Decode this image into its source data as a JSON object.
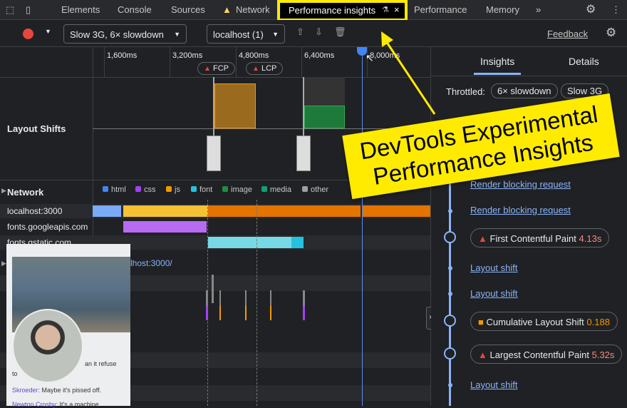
{
  "tabs": {
    "items": [
      "Elements",
      "Console",
      "Sources",
      "Network",
      "Performance insights",
      "Performance",
      "Memory"
    ],
    "more": "»",
    "active": "Performance insights"
  },
  "toolbar": {
    "throttle": "Slow 3G, 6× slowdown",
    "target": "localhost (1)",
    "feedback": "Feedback"
  },
  "ruler": {
    "ticks": [
      "1,600ms",
      "3,200ms",
      "4,800ms",
      "6,400ms",
      "8,000ms"
    ],
    "markers": [
      "FCP",
      "LCP"
    ]
  },
  "tracks": {
    "layout_shifts": "Layout Shifts",
    "network": "Network"
  },
  "legend": [
    {
      "label": "html",
      "color": "#4285f4"
    },
    {
      "label": "css",
      "color": "#a142f4"
    },
    {
      "label": "js",
      "color": "#f29900"
    },
    {
      "label": "font",
      "color": "#24c1e0"
    },
    {
      "label": "image",
      "color": "#1e8e3e"
    },
    {
      "label": "media",
      "color": "#129e7a"
    },
    {
      "label": "other",
      "color": "#9aa0a6"
    }
  ],
  "network_rows": [
    "localhost:3000",
    "fonts.googleapis.com",
    "fonts.gstatic.com"
  ],
  "main_thread_url": "lhost:3000/",
  "side": {
    "tabs": [
      "Insights",
      "Details"
    ],
    "throttled_label": "Throttled:",
    "throttle_chips": [
      "6× slowdown",
      "Slow 3G"
    ],
    "items": [
      {
        "type": "link",
        "label": "Render blocking request"
      },
      {
        "type": "link",
        "label": "Render blocking request"
      },
      {
        "type": "metric",
        "icon": "triangle",
        "label": "First Contentful Paint",
        "value": "4.13s",
        "color": "#f28b82"
      },
      {
        "type": "link",
        "label": "Layout shift"
      },
      {
        "type": "link",
        "label": "Layout shift"
      },
      {
        "type": "metric",
        "icon": "square",
        "label": "Cumulative Layout Shift",
        "value": "0.188",
        "color": "#f29900"
      },
      {
        "type": "metric",
        "icon": "triangle",
        "label": "Largest Contentful Paint",
        "value": "5.32s",
        "color": "#f28b82"
      },
      {
        "type": "link",
        "label": "Layout shift"
      }
    ]
  },
  "overlay": {
    "chat": [
      {
        "user": "",
        "text": "an it refuse"
      },
      {
        "user": "",
        "text": "to"
      },
      {
        "user": "Skroeder:",
        "text": " Maybe it's pissed off."
      },
      {
        "user": "Newton Crosby:",
        "text": " It's a machine"
      }
    ]
  },
  "annotation": {
    "line1": "DevTools Experimental",
    "line2": "Performance Insights",
    "color": "#ffeb00"
  }
}
